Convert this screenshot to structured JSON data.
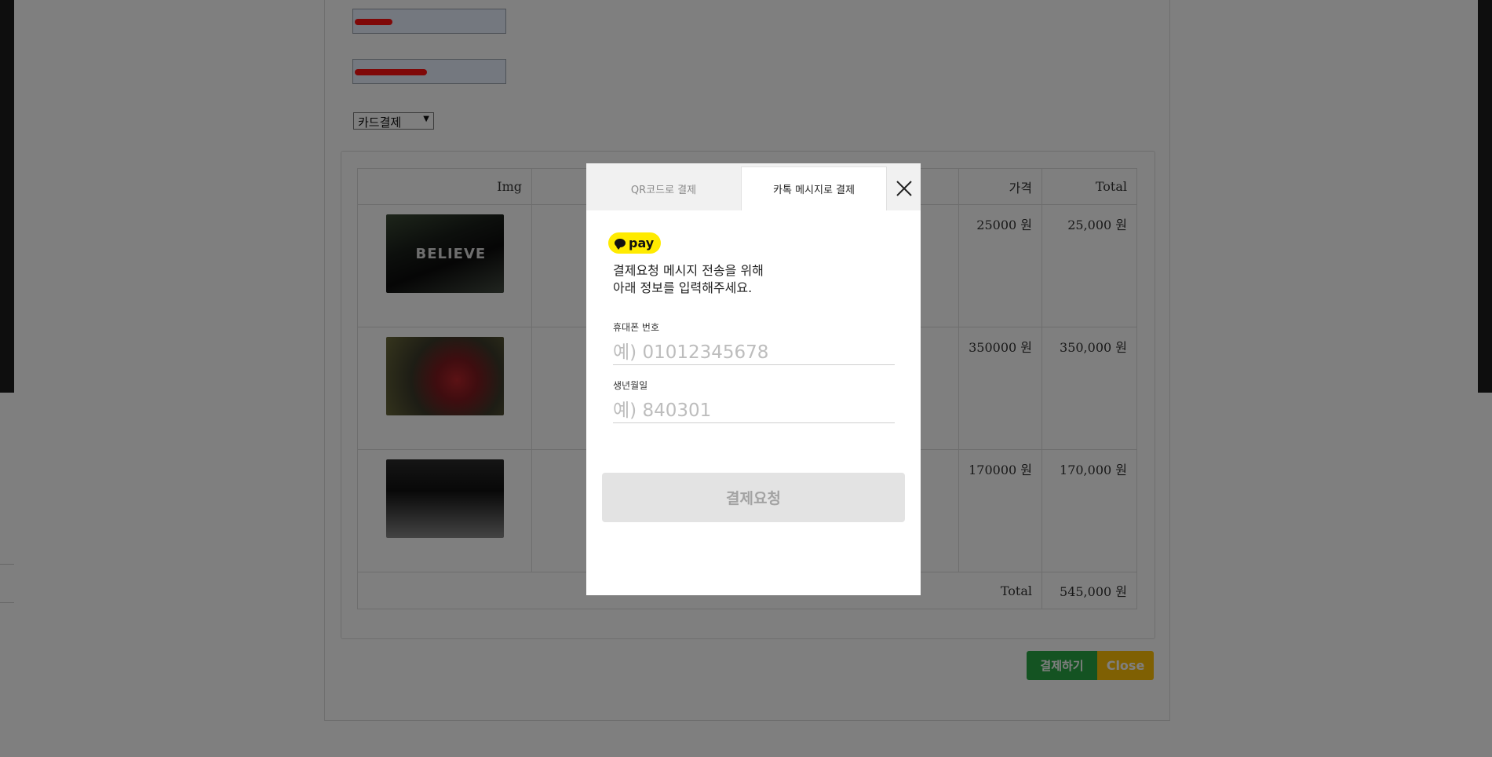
{
  "form": {
    "name_value": "",
    "phone_value": "",
    "payment_method_selected": "카드결제"
  },
  "table": {
    "headers": {
      "img": "Img",
      "description": "",
      "price": "가격",
      "total": "Total"
    },
    "rows": [
      {
        "thumb_text": "BELIEVE",
        "price": "25000 원",
        "total": "25,000 원"
      },
      {
        "thumb_text": "",
        "price": "350000 원",
        "total": "350,000 원"
      },
      {
        "thumb_text": "",
        "price": "170000 원",
        "total": "170,000 원"
      }
    ],
    "footer_label": "Total",
    "footer_total": "545,000 원"
  },
  "actions": {
    "pay_label": "결제하기",
    "close_label": "Close"
  },
  "modal": {
    "tabs": {
      "qr": "QR코드로 결제",
      "kakao": "카톡 메시지로 결제"
    },
    "badge": "pay",
    "desc_line1": "결제요청 메시지 전송을 위해",
    "desc_line2": "아래 정보를 입력해주세요.",
    "phone_label": "휴대폰 번호",
    "phone_placeholder": "예) 01012345678",
    "birth_label": "생년월일",
    "birth_placeholder": "예) 840301",
    "submit_label": "결제요청"
  },
  "colors": {
    "kakao_yellow": "#ffeb00",
    "pay_green": "#28a745",
    "close_yellow": "#ffc107"
  }
}
